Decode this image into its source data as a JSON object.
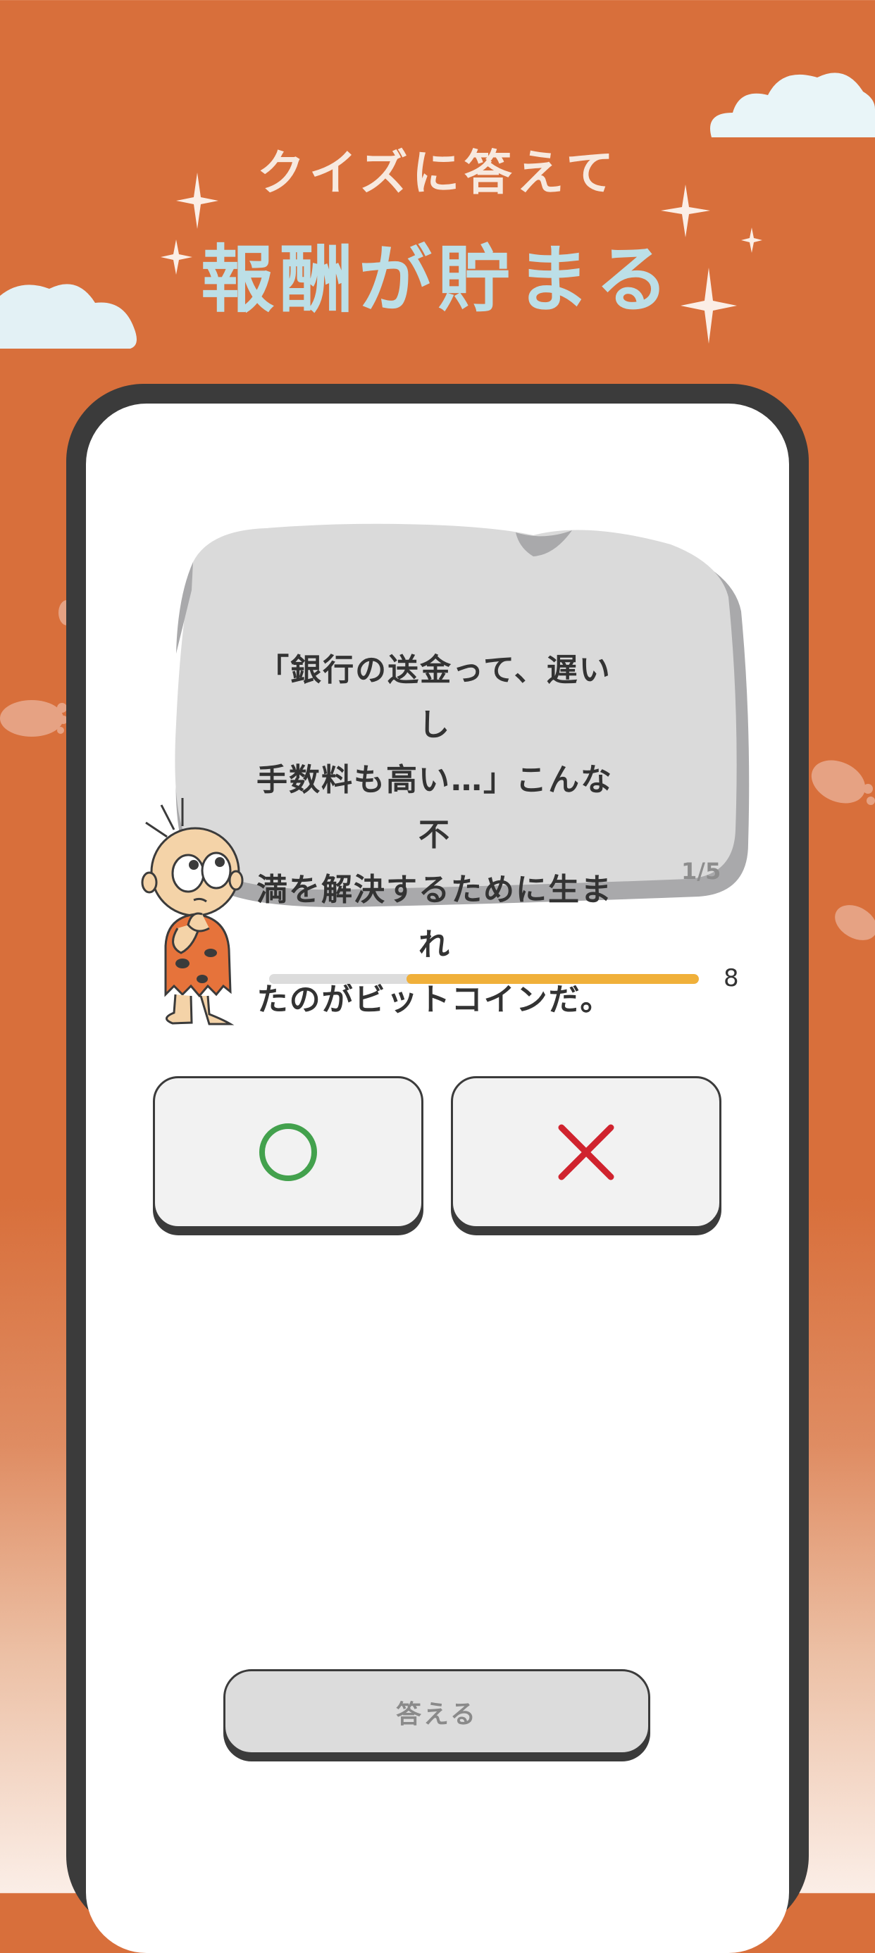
{
  "promo": {
    "headline_small": "クイズに答えて",
    "headline_big": "報酬が貯まる"
  },
  "quiz": {
    "question_lines": [
      "「銀行の送金って、遅いし",
      "手数料も高い…」こんな不",
      "満を解決するために生まれ",
      "たのがビットコインだ。"
    ],
    "counter": "1/5",
    "progress_value": 8,
    "answer_true_icon": "circle-icon",
    "answer_false_icon": "cross-icon",
    "submit_label": "答える"
  },
  "colors": {
    "background": "#d86f3b",
    "headline_big": "#bcdfe7",
    "progress_fill": "#f0b03a",
    "correct_mark": "#43a14d",
    "wrong_mark": "#d0232e"
  }
}
